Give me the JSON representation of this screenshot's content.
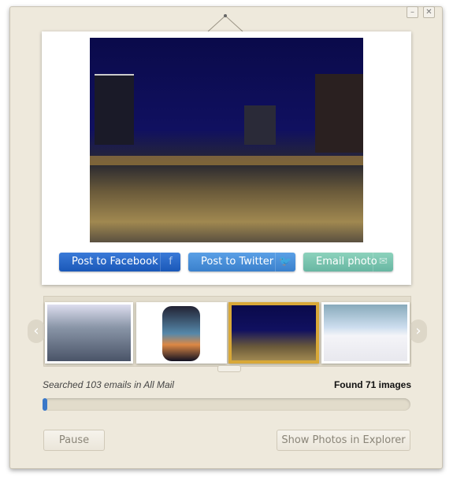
{
  "window": {
    "minimize_icon": "minimize-icon",
    "close_icon": "close-icon"
  },
  "share": {
    "facebook": "Post to Facebook",
    "twitter": "Post to Twitter",
    "email": "Email photo",
    "colors": {
      "facebook": "#2a68c8",
      "twitter": "#4a90d6",
      "email": "#7cc4b0"
    }
  },
  "status": {
    "searched": "Searched 103 emails in All Mail",
    "found": "Found 71 images",
    "progress_percent": 1
  },
  "buttons": {
    "pause": "Pause",
    "show": "Show Photos in Explorer"
  },
  "thumbnails": [
    {
      "name": "clouds"
    },
    {
      "name": "airplane-window"
    },
    {
      "name": "night-city",
      "selected": true
    },
    {
      "name": "ski-slope"
    }
  ]
}
